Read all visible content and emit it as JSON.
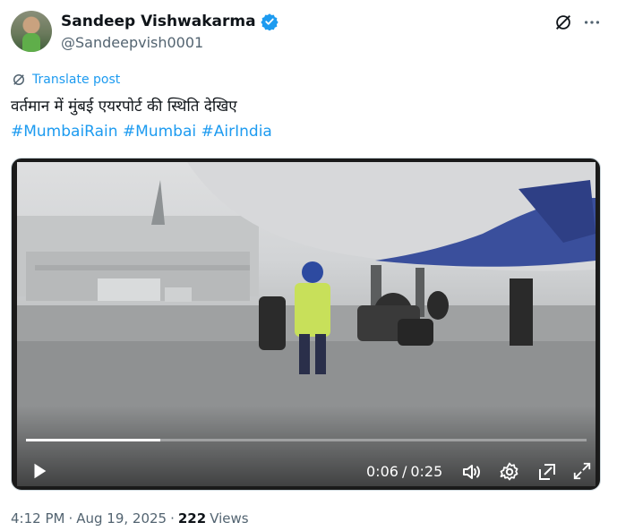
{
  "author": {
    "name": "Sandeep Vishwakarma",
    "handle": "@Sandeepvish0001",
    "verified": true
  },
  "translate_label": "Translate post",
  "tweet_text": "वर्तमान में मुंबई एयरपोर्ट की स्थिति देखिए",
  "hashtags": [
    "#MumbaiRain",
    "#Mumbai",
    "#AirIndia"
  ],
  "video": {
    "current_time": "0:06",
    "separator": "/",
    "duration": "0:25",
    "progress": 0.24
  },
  "meta": {
    "time": "4:12 PM",
    "date": "Aug 19, 2025",
    "dot": "·",
    "views_count": "222",
    "views_label": "Views"
  },
  "colors": {
    "accent": "#1d9bf0",
    "secondary_text": "#536471",
    "primary_text": "#0f1419"
  },
  "icons": [
    "grok-icon",
    "more-icon",
    "translate-icon",
    "verified-badge-icon",
    "play-icon",
    "volume-icon",
    "settings-icon",
    "dock-icon",
    "fullscreen-icon"
  ]
}
